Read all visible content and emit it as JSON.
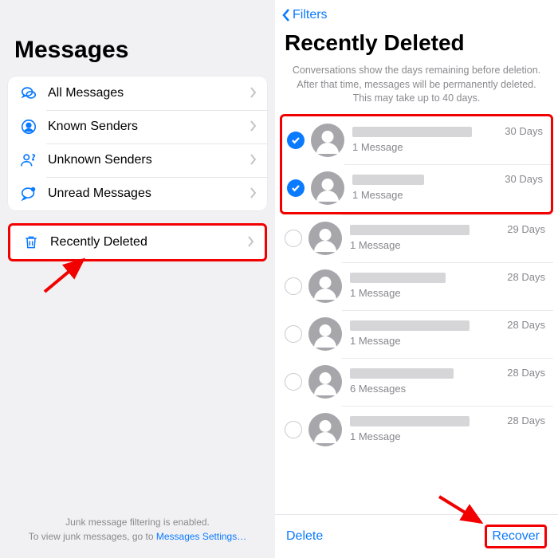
{
  "left": {
    "title": "Messages",
    "filters": [
      {
        "icon": "chat-bubbles",
        "label": "All Messages"
      },
      {
        "icon": "person-circle",
        "label": "Known Senders"
      },
      {
        "icon": "person-question",
        "label": "Unknown Senders"
      },
      {
        "icon": "chat-dot",
        "label": "Unread Messages"
      }
    ],
    "recently_deleted_label": "Recently Deleted",
    "footer_line1": "Junk message filtering is enabled.",
    "footer_line2_a": "To view junk messages, go to ",
    "footer_link": "Messages Settings…"
  },
  "right": {
    "back_label": "Filters",
    "title": "Recently Deleted",
    "info_l1": "Conversations show the days remaining before deletion.",
    "info_l2": "After that time, messages will be permanently deleted.",
    "info_l3": "This may take up to 40 days.",
    "conversations": [
      {
        "selected": true,
        "name_w": 150,
        "msg": "1 Message",
        "days": "30 Days"
      },
      {
        "selected": true,
        "name_w": 90,
        "msg": "1 Message",
        "days": "30 Days"
      },
      {
        "selected": false,
        "name_w": 150,
        "msg": "1 Message",
        "days": "29 Days"
      },
      {
        "selected": false,
        "name_w": 120,
        "msg": "1 Message",
        "days": "28 Days"
      },
      {
        "selected": false,
        "name_w": 150,
        "msg": "1 Message",
        "days": "28 Days"
      },
      {
        "selected": false,
        "name_w": 130,
        "msg": "6 Messages",
        "days": "28 Days"
      },
      {
        "selected": false,
        "name_w": 150,
        "msg": "1 Message",
        "days": "28 Days"
      }
    ],
    "delete_label": "Delete",
    "recover_label": "Recover"
  }
}
